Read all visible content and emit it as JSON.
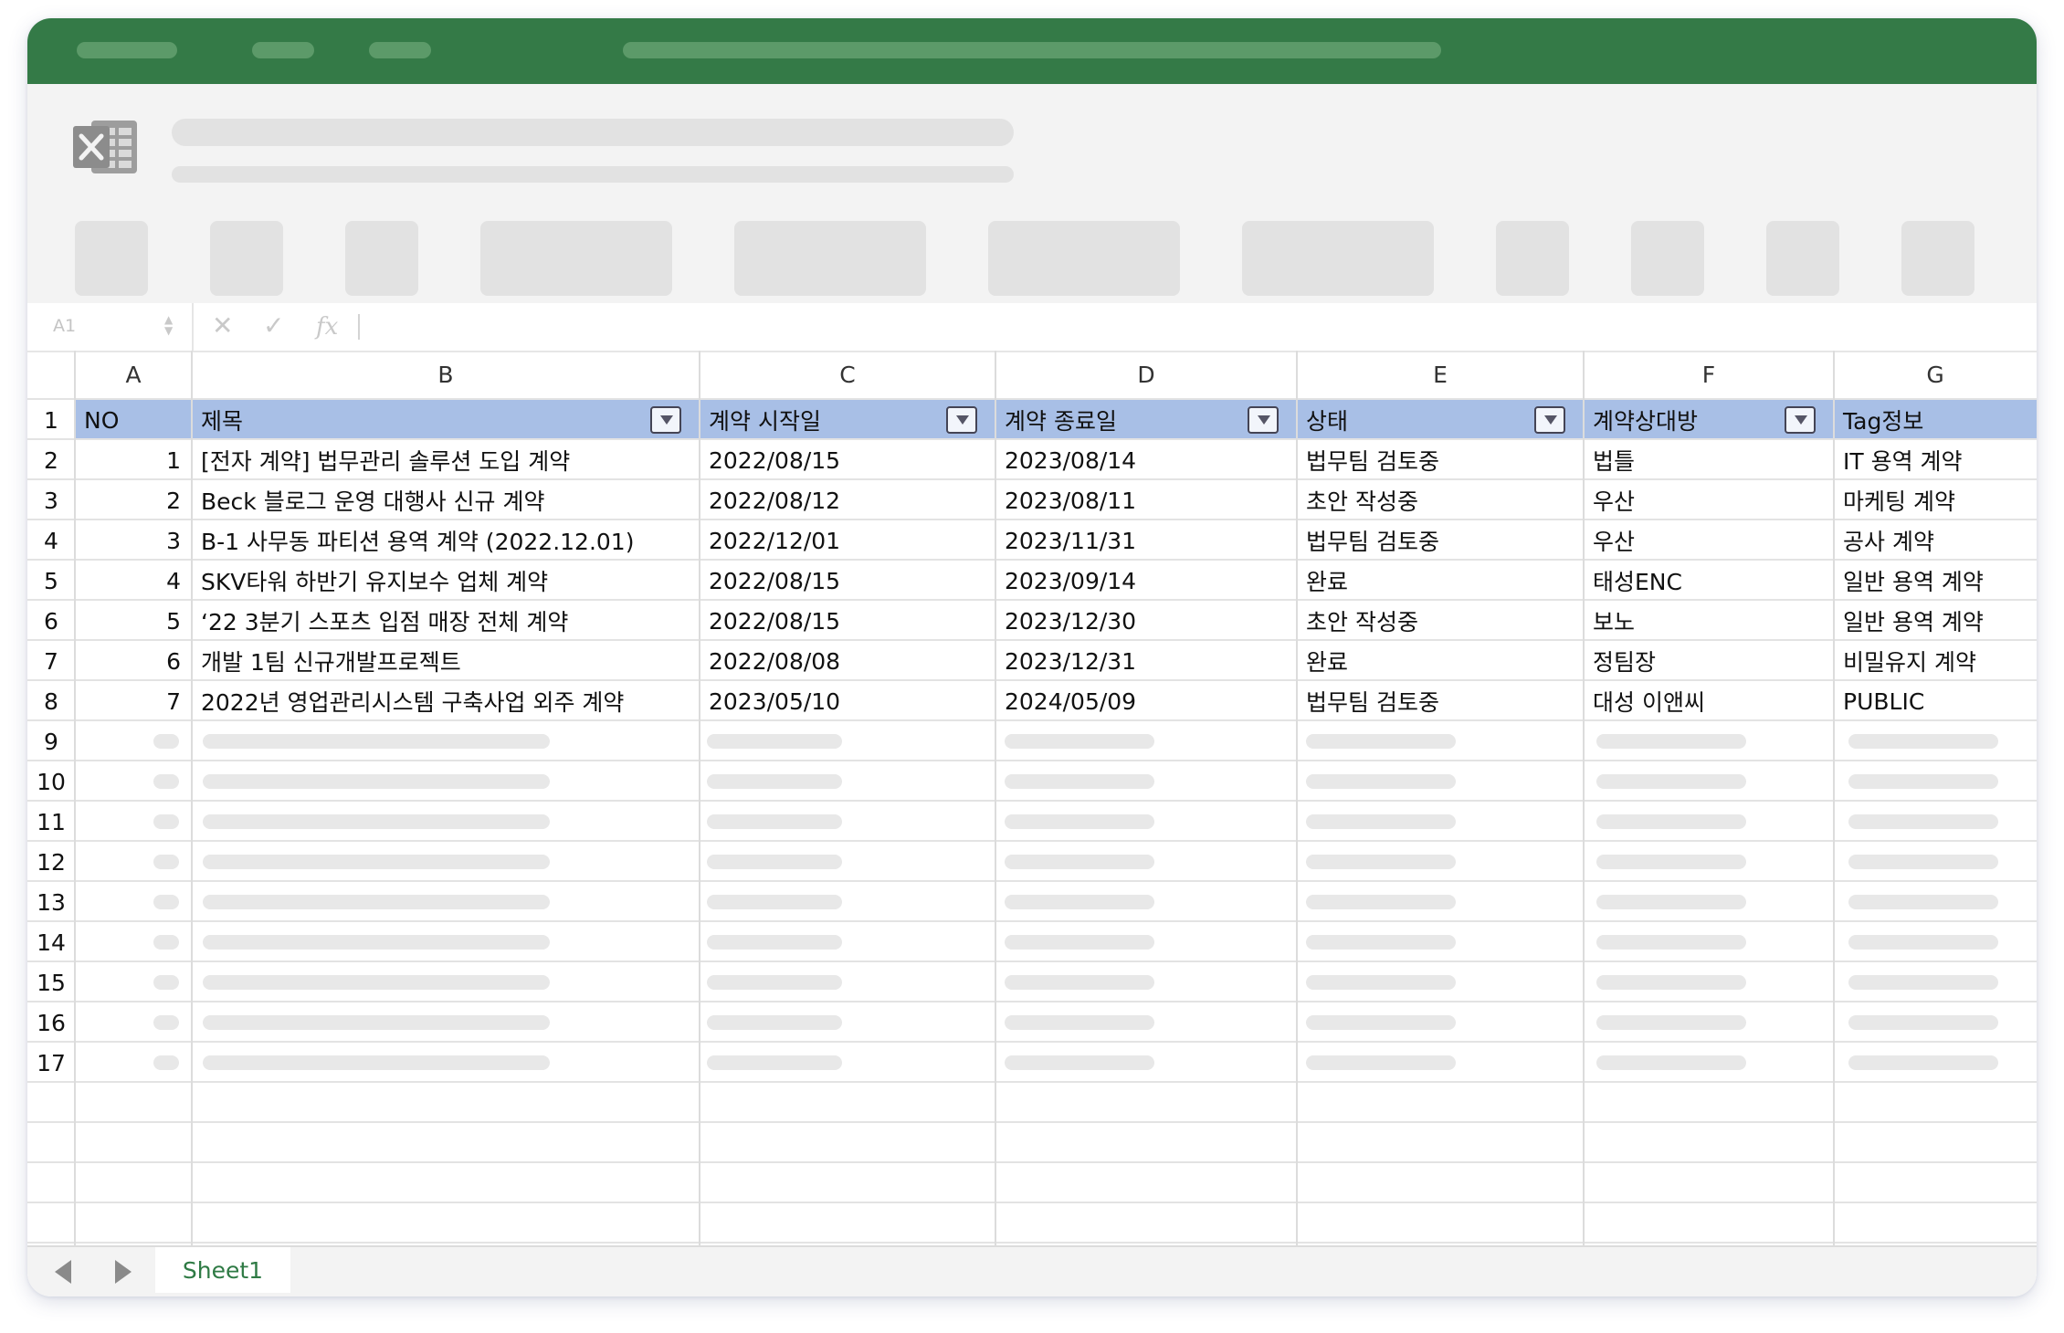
{
  "colors": {
    "accent": "#347a47",
    "header_fill": "#a8bfe6",
    "tab_text": "#2e7a44"
  },
  "app": {
    "logo_icon": "excel-logo-icon"
  },
  "formula_bar": {
    "name_box": "A1",
    "cancel_icon": "close-icon",
    "enter_icon": "check-icon",
    "function_label": "fx"
  },
  "columns": [
    "A",
    "B",
    "C",
    "D",
    "E",
    "F",
    "G"
  ],
  "rows": [
    "1",
    "2",
    "3",
    "4",
    "5",
    "6",
    "7",
    "8",
    "9",
    "10",
    "11",
    "12",
    "13",
    "14",
    "15",
    "16",
    "17"
  ],
  "table": {
    "headers": [
      "NO",
      "제목",
      "계약 시작일",
      "계약 종료일",
      "상태",
      "계약상대방",
      "Tag정보"
    ],
    "filter_columns": [
      1,
      2,
      3,
      4,
      5
    ],
    "rows": [
      [
        "1",
        "[전자 계약] 법무관리 솔루션 도입 계약",
        "2022/08/15",
        "2023/08/14",
        "법무팀 검토중",
        "법틀",
        "IT 용역 계약"
      ],
      [
        "2",
        "Beck 블로그 운영 대행사 신규 계약",
        "2022/08/12",
        "2023/08/11",
        "초안 작성중",
        "우산",
        "마케팅 계약"
      ],
      [
        "3",
        "B-1 사무동 파티션 용역 계약 (2022.12.01)",
        "2022/12/01",
        "2023/11/31",
        "법무팀 검토중",
        "우산",
        "공사 계약"
      ],
      [
        "4",
        "SKV타워 하반기 유지보수 업체 계약",
        "2022/08/15",
        "2023/09/14",
        "완료",
        "태성ENC",
        "일반 용역 계약"
      ],
      [
        "5",
        "‘22 3분기 스포츠 입점 매장 전체 계약",
        "2022/08/15",
        "2023/12/30",
        "초안 작성중",
        "보노",
        "일반 용역 계약"
      ],
      [
        "6",
        "개발 1팀 신규개발프로젝트",
        "2022/08/08",
        "2023/12/31",
        "완료",
        "정팀장",
        "비밀유지 계약"
      ],
      [
        "7",
        "2022년 영업관리시스템 구축사업 외주 계약",
        "2023/05/10",
        "2024/05/09",
        "법무팀 검토중",
        "대성 이앤씨",
        "PUBLIC"
      ]
    ]
  },
  "sheets": {
    "active": "Sheet1",
    "prev_icon": "chevron-left-icon",
    "next_icon": "chevron-right-icon"
  }
}
